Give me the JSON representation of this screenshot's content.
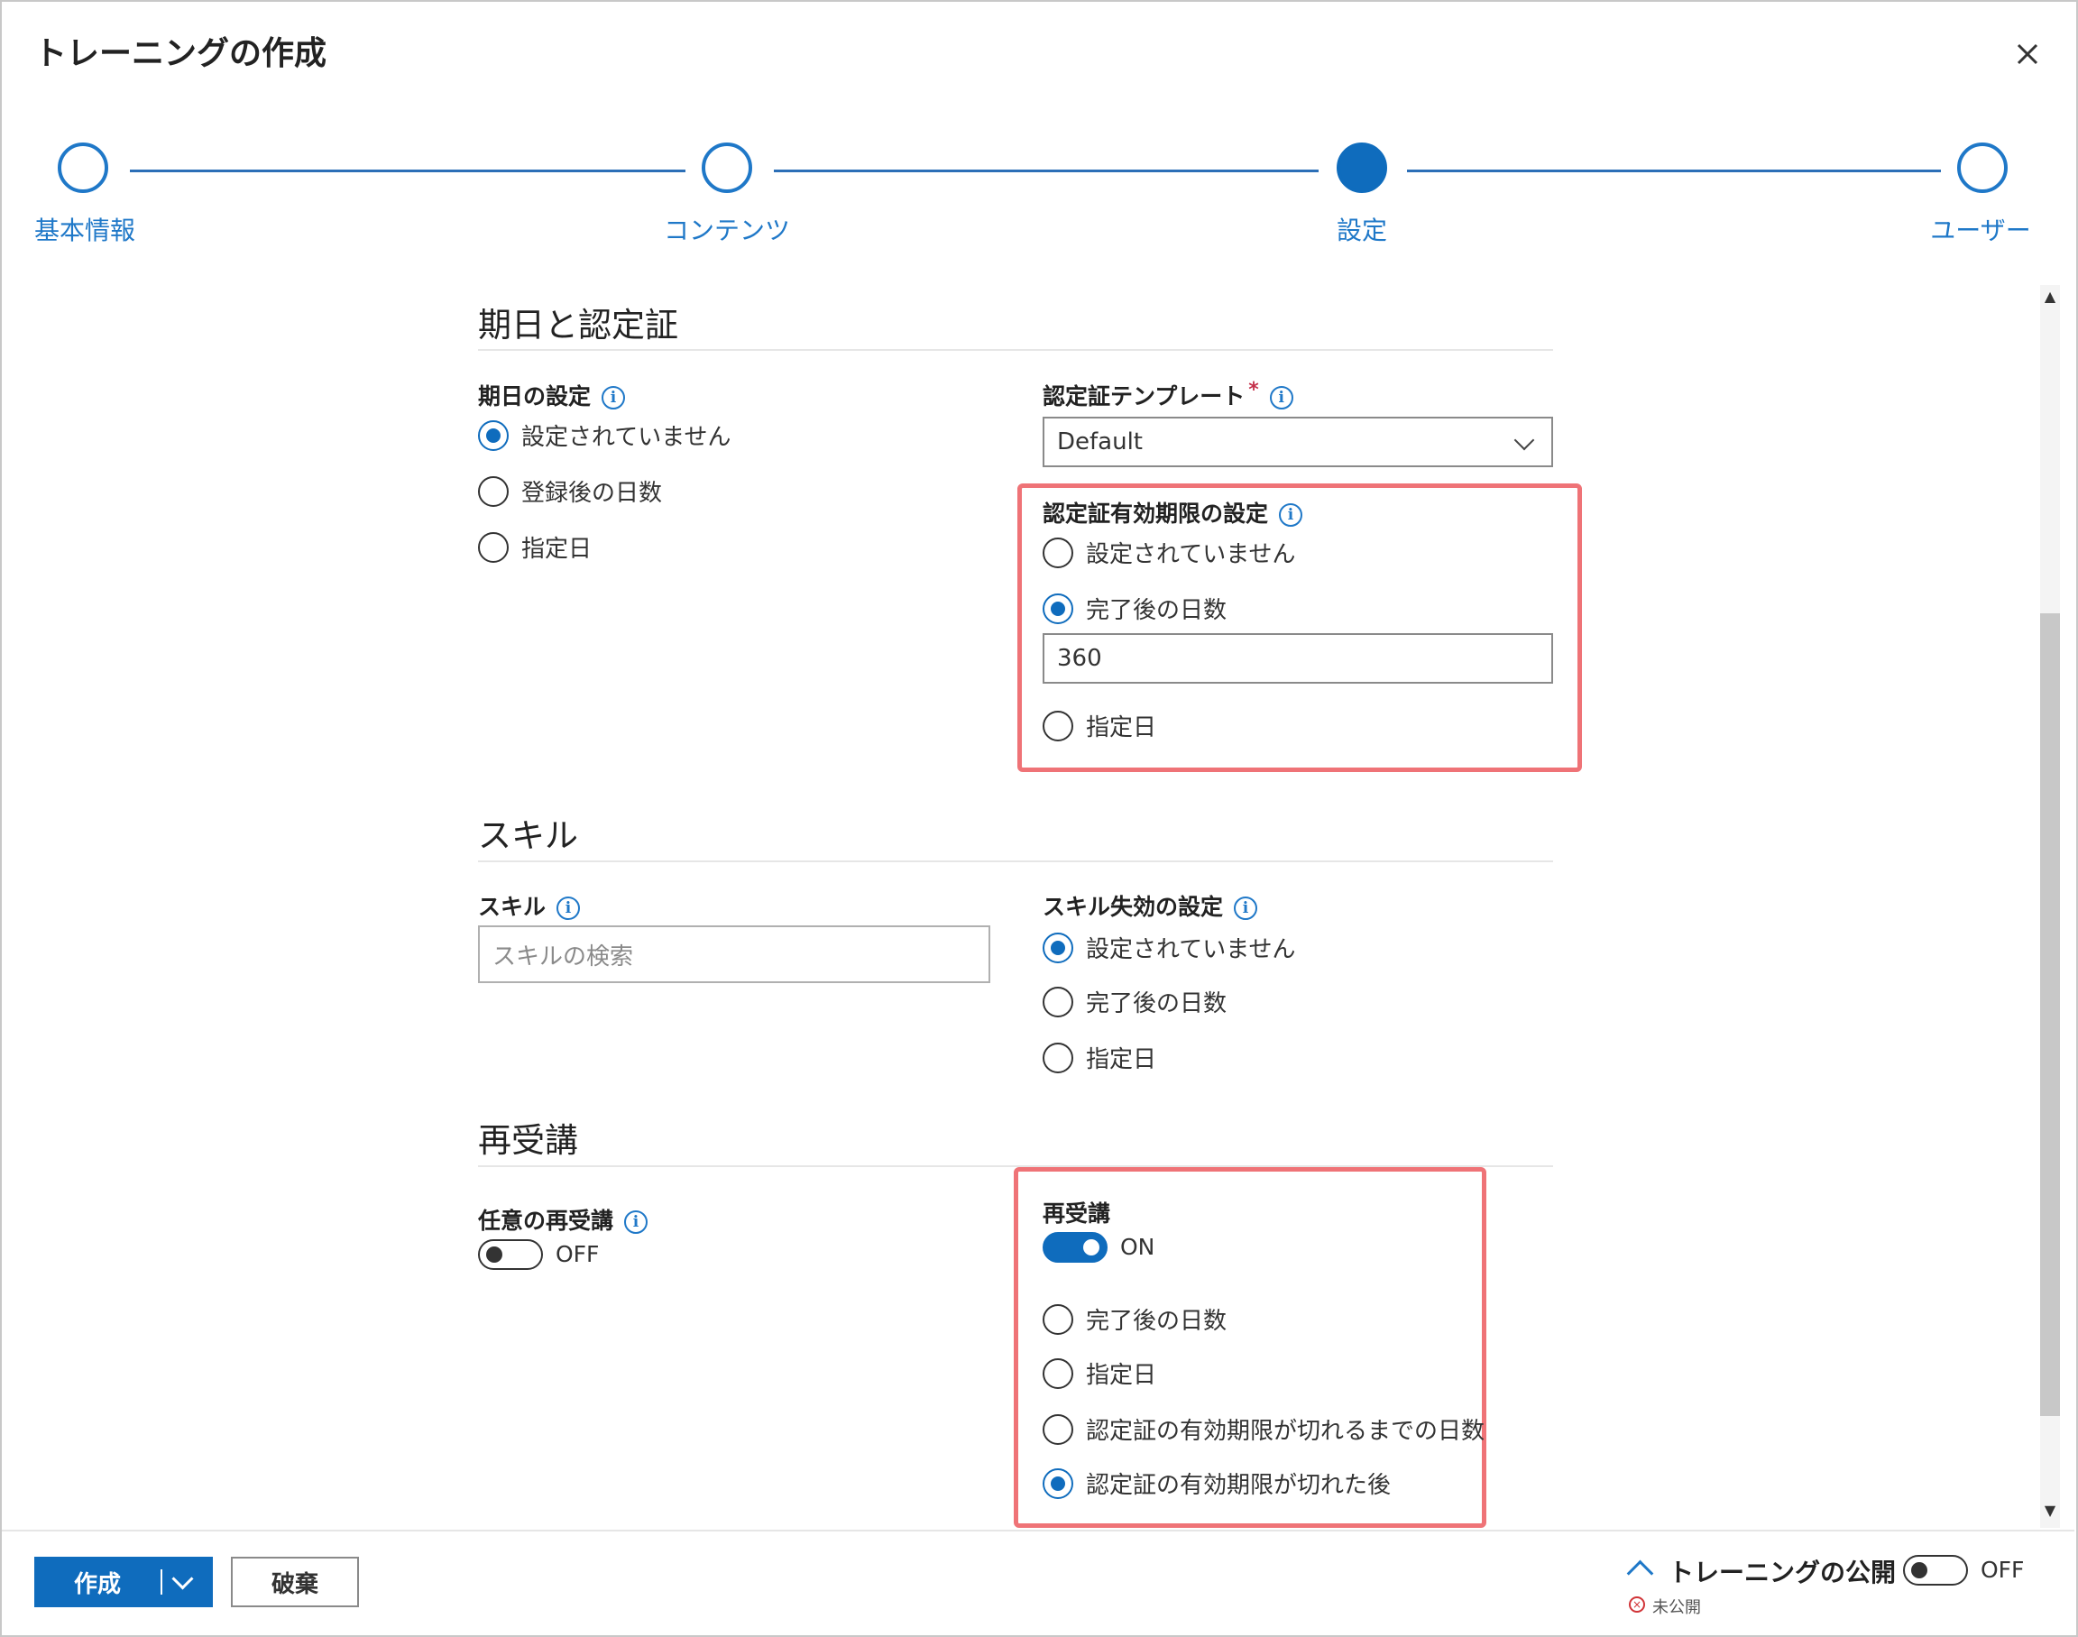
{
  "dialog": {
    "title": "トレーニングの作成",
    "close_icon": "close-icon"
  },
  "stepper": {
    "steps": [
      {
        "label": "基本情報",
        "state": "inactive"
      },
      {
        "label": "コンテンツ",
        "state": "inactive"
      },
      {
        "label": "設定",
        "state": "active"
      },
      {
        "label": "ユーザー",
        "state": "inactive"
      }
    ]
  },
  "sections": {
    "due_cert": {
      "title": "期日と認定証",
      "due_date": {
        "label": "期日の設定",
        "options": [
          "設定されていません",
          "登録後の日数",
          "指定日"
        ],
        "selected": 0
      },
      "cert_template": {
        "label": "認定証テンプレート",
        "required_mark": "*",
        "value": "Default"
      },
      "cert_expiry": {
        "label": "認定証有効期限の設定",
        "options": [
          "設定されていません",
          "完了後の日数",
          "指定日"
        ],
        "selected": 1,
        "days_value": "360"
      }
    },
    "skills": {
      "title": "スキル",
      "skill": {
        "label": "スキル",
        "placeholder": "スキルの検索"
      },
      "skill_expiry": {
        "label": "スキル失効の設定",
        "options": [
          "設定されていません",
          "完了後の日数",
          "指定日"
        ],
        "selected": 0
      }
    },
    "retake": {
      "title": "再受講",
      "optional_retake": {
        "label": "任意の再受講",
        "toggle_text": "OFF",
        "on": false
      },
      "retake": {
        "label": "再受講",
        "toggle_text": "ON",
        "on": true,
        "options": [
          "完了後の日数",
          "指定日",
          "認定証の有効期限が切れるまでの日数",
          "認定証の有効期限が切れた後"
        ],
        "selected": 3
      }
    }
  },
  "footer": {
    "create_label": "作成",
    "discard_label": "破棄",
    "publish_label": "トレーニングの公開",
    "publish_toggle_text": "OFF",
    "publish_status": "未公開"
  },
  "colors": {
    "accent": "#0f6cbd",
    "highlight": "#ef7377",
    "step_line": "#2c6fb7"
  }
}
